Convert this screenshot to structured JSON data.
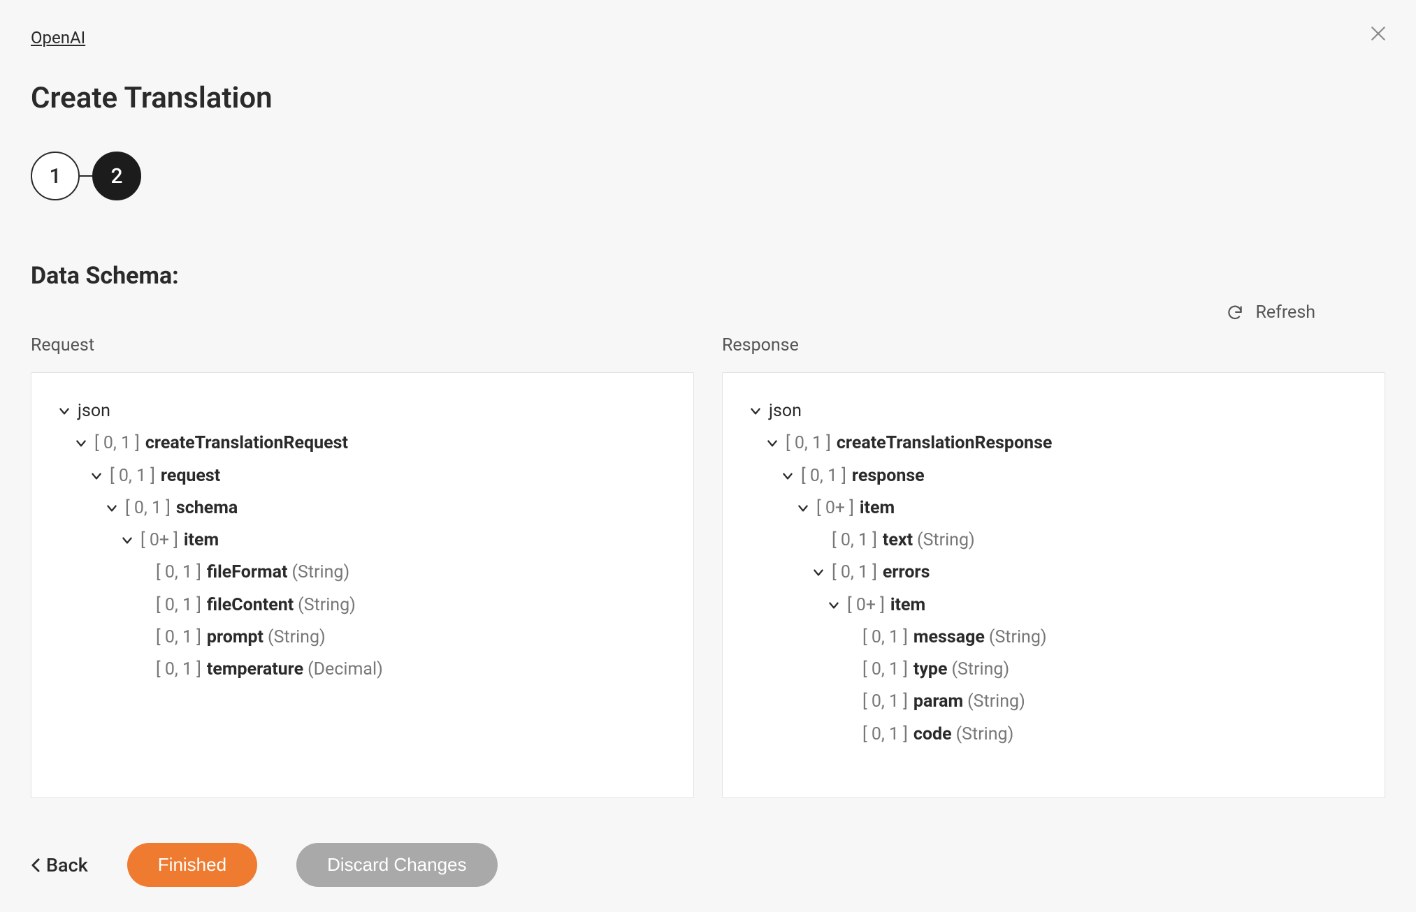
{
  "breadcrumb": {
    "root": "OpenAI"
  },
  "page": {
    "title": "Create Translation"
  },
  "stepper": {
    "steps": [
      "1",
      "2"
    ],
    "active_index": 1
  },
  "section": {
    "heading": "Data Schema:"
  },
  "refresh": {
    "label": "Refresh"
  },
  "columns": {
    "request_title": "Request",
    "response_title": "Response"
  },
  "request_tree": [
    {
      "indent": 0,
      "chevron": true,
      "card": "",
      "name": "json",
      "type": "",
      "root": true
    },
    {
      "indent": 1,
      "chevron": true,
      "card": "[ 0, 1 ]",
      "name": "createTranslationRequest",
      "type": ""
    },
    {
      "indent": 2,
      "chevron": true,
      "card": "[ 0, 1 ]",
      "name": "request",
      "type": ""
    },
    {
      "indent": 3,
      "chevron": true,
      "card": "[ 0, 1 ]",
      "name": "schema",
      "type": ""
    },
    {
      "indent": 4,
      "chevron": true,
      "card": "[ 0+ ]",
      "name": "item",
      "type": ""
    },
    {
      "indent": 5,
      "chevron": false,
      "card": "[ 0, 1 ]",
      "name": "fileFormat",
      "type": "(String)"
    },
    {
      "indent": 5,
      "chevron": false,
      "card": "[ 0, 1 ]",
      "name": "fileContent",
      "type": "(String)"
    },
    {
      "indent": 5,
      "chevron": false,
      "card": "[ 0, 1 ]",
      "name": "prompt",
      "type": "(String)"
    },
    {
      "indent": 5,
      "chevron": false,
      "card": "[ 0, 1 ]",
      "name": "temperature",
      "type": "(Decimal)"
    }
  ],
  "response_tree": [
    {
      "indent": 0,
      "chevron": true,
      "card": "",
      "name": "json",
      "type": "",
      "root": true
    },
    {
      "indent": 1,
      "chevron": true,
      "card": "[ 0, 1 ]",
      "name": "createTranslationResponse",
      "type": ""
    },
    {
      "indent": 2,
      "chevron": true,
      "card": "[ 0, 1 ]",
      "name": "response",
      "type": ""
    },
    {
      "indent": 3,
      "chevron": true,
      "card": "[ 0+ ]",
      "name": "item",
      "type": ""
    },
    {
      "indent": 4,
      "chevron": false,
      "card": "[ 0, 1 ]",
      "name": "text",
      "type": "(String)"
    },
    {
      "indent": 4,
      "chevron": true,
      "card": "[ 0, 1 ]",
      "name": "errors",
      "type": ""
    },
    {
      "indent": 5,
      "chevron": true,
      "card": "[ 0+ ]",
      "name": "item",
      "type": ""
    },
    {
      "indent": 6,
      "chevron": false,
      "card": "[ 0, 1 ]",
      "name": "message",
      "type": "(String)"
    },
    {
      "indent": 6,
      "chevron": false,
      "card": "[ 0, 1 ]",
      "name": "type",
      "type": "(String)"
    },
    {
      "indent": 6,
      "chevron": false,
      "card": "[ 0, 1 ]",
      "name": "param",
      "type": "(String)"
    },
    {
      "indent": 6,
      "chevron": false,
      "card": "[ 0, 1 ]",
      "name": "code",
      "type": "(String)"
    }
  ],
  "footer": {
    "back": "Back",
    "finished": "Finished",
    "discard": "Discard Changes"
  }
}
